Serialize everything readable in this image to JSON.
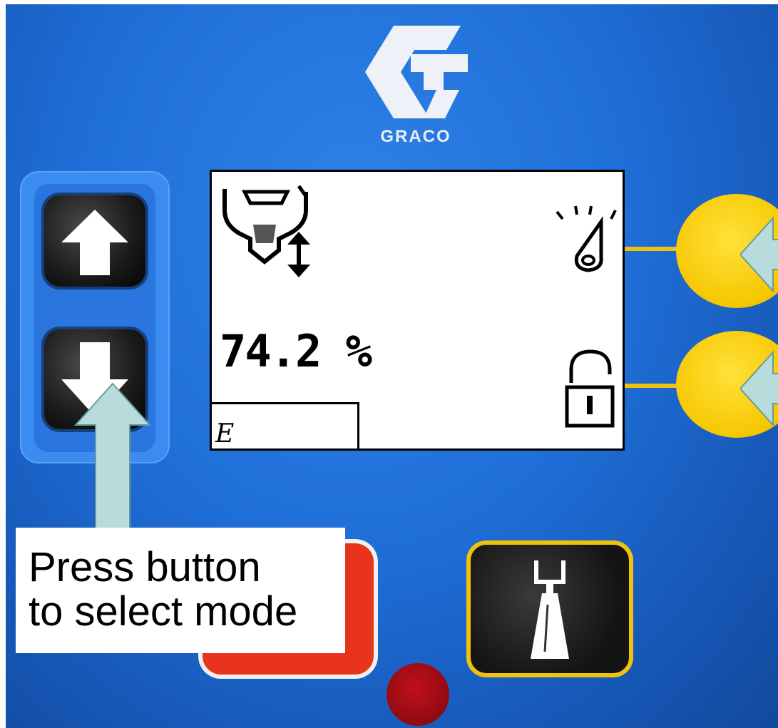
{
  "logo": {
    "brand_text": "GRACO",
    "icon": "graco-g-logo"
  },
  "display": {
    "value_text": "74.2 %",
    "status_text": "E",
    "icons": [
      "spray-gun-mode-icon",
      "up-down-adjust-icon",
      "fluid-drop-icon",
      "unlocked-padlock-icon"
    ]
  },
  "buttons": {
    "up": "up-arrow-icon",
    "down": "down-arrow-icon",
    "spray": "spray-tip-icon",
    "stop": "stop-icon",
    "yellow_top": "softkey-top",
    "yellow_bottom": "softkey-bottom"
  },
  "callout": {
    "line1": "Press button",
    "line2": "to select mode"
  },
  "colors": {
    "panel": "#1f6fd8",
    "softkey": "#f6c600",
    "stop": "#e8341c",
    "callout_arrow": "#b8dcdc",
    "spray_ring": "#f1c20b"
  }
}
